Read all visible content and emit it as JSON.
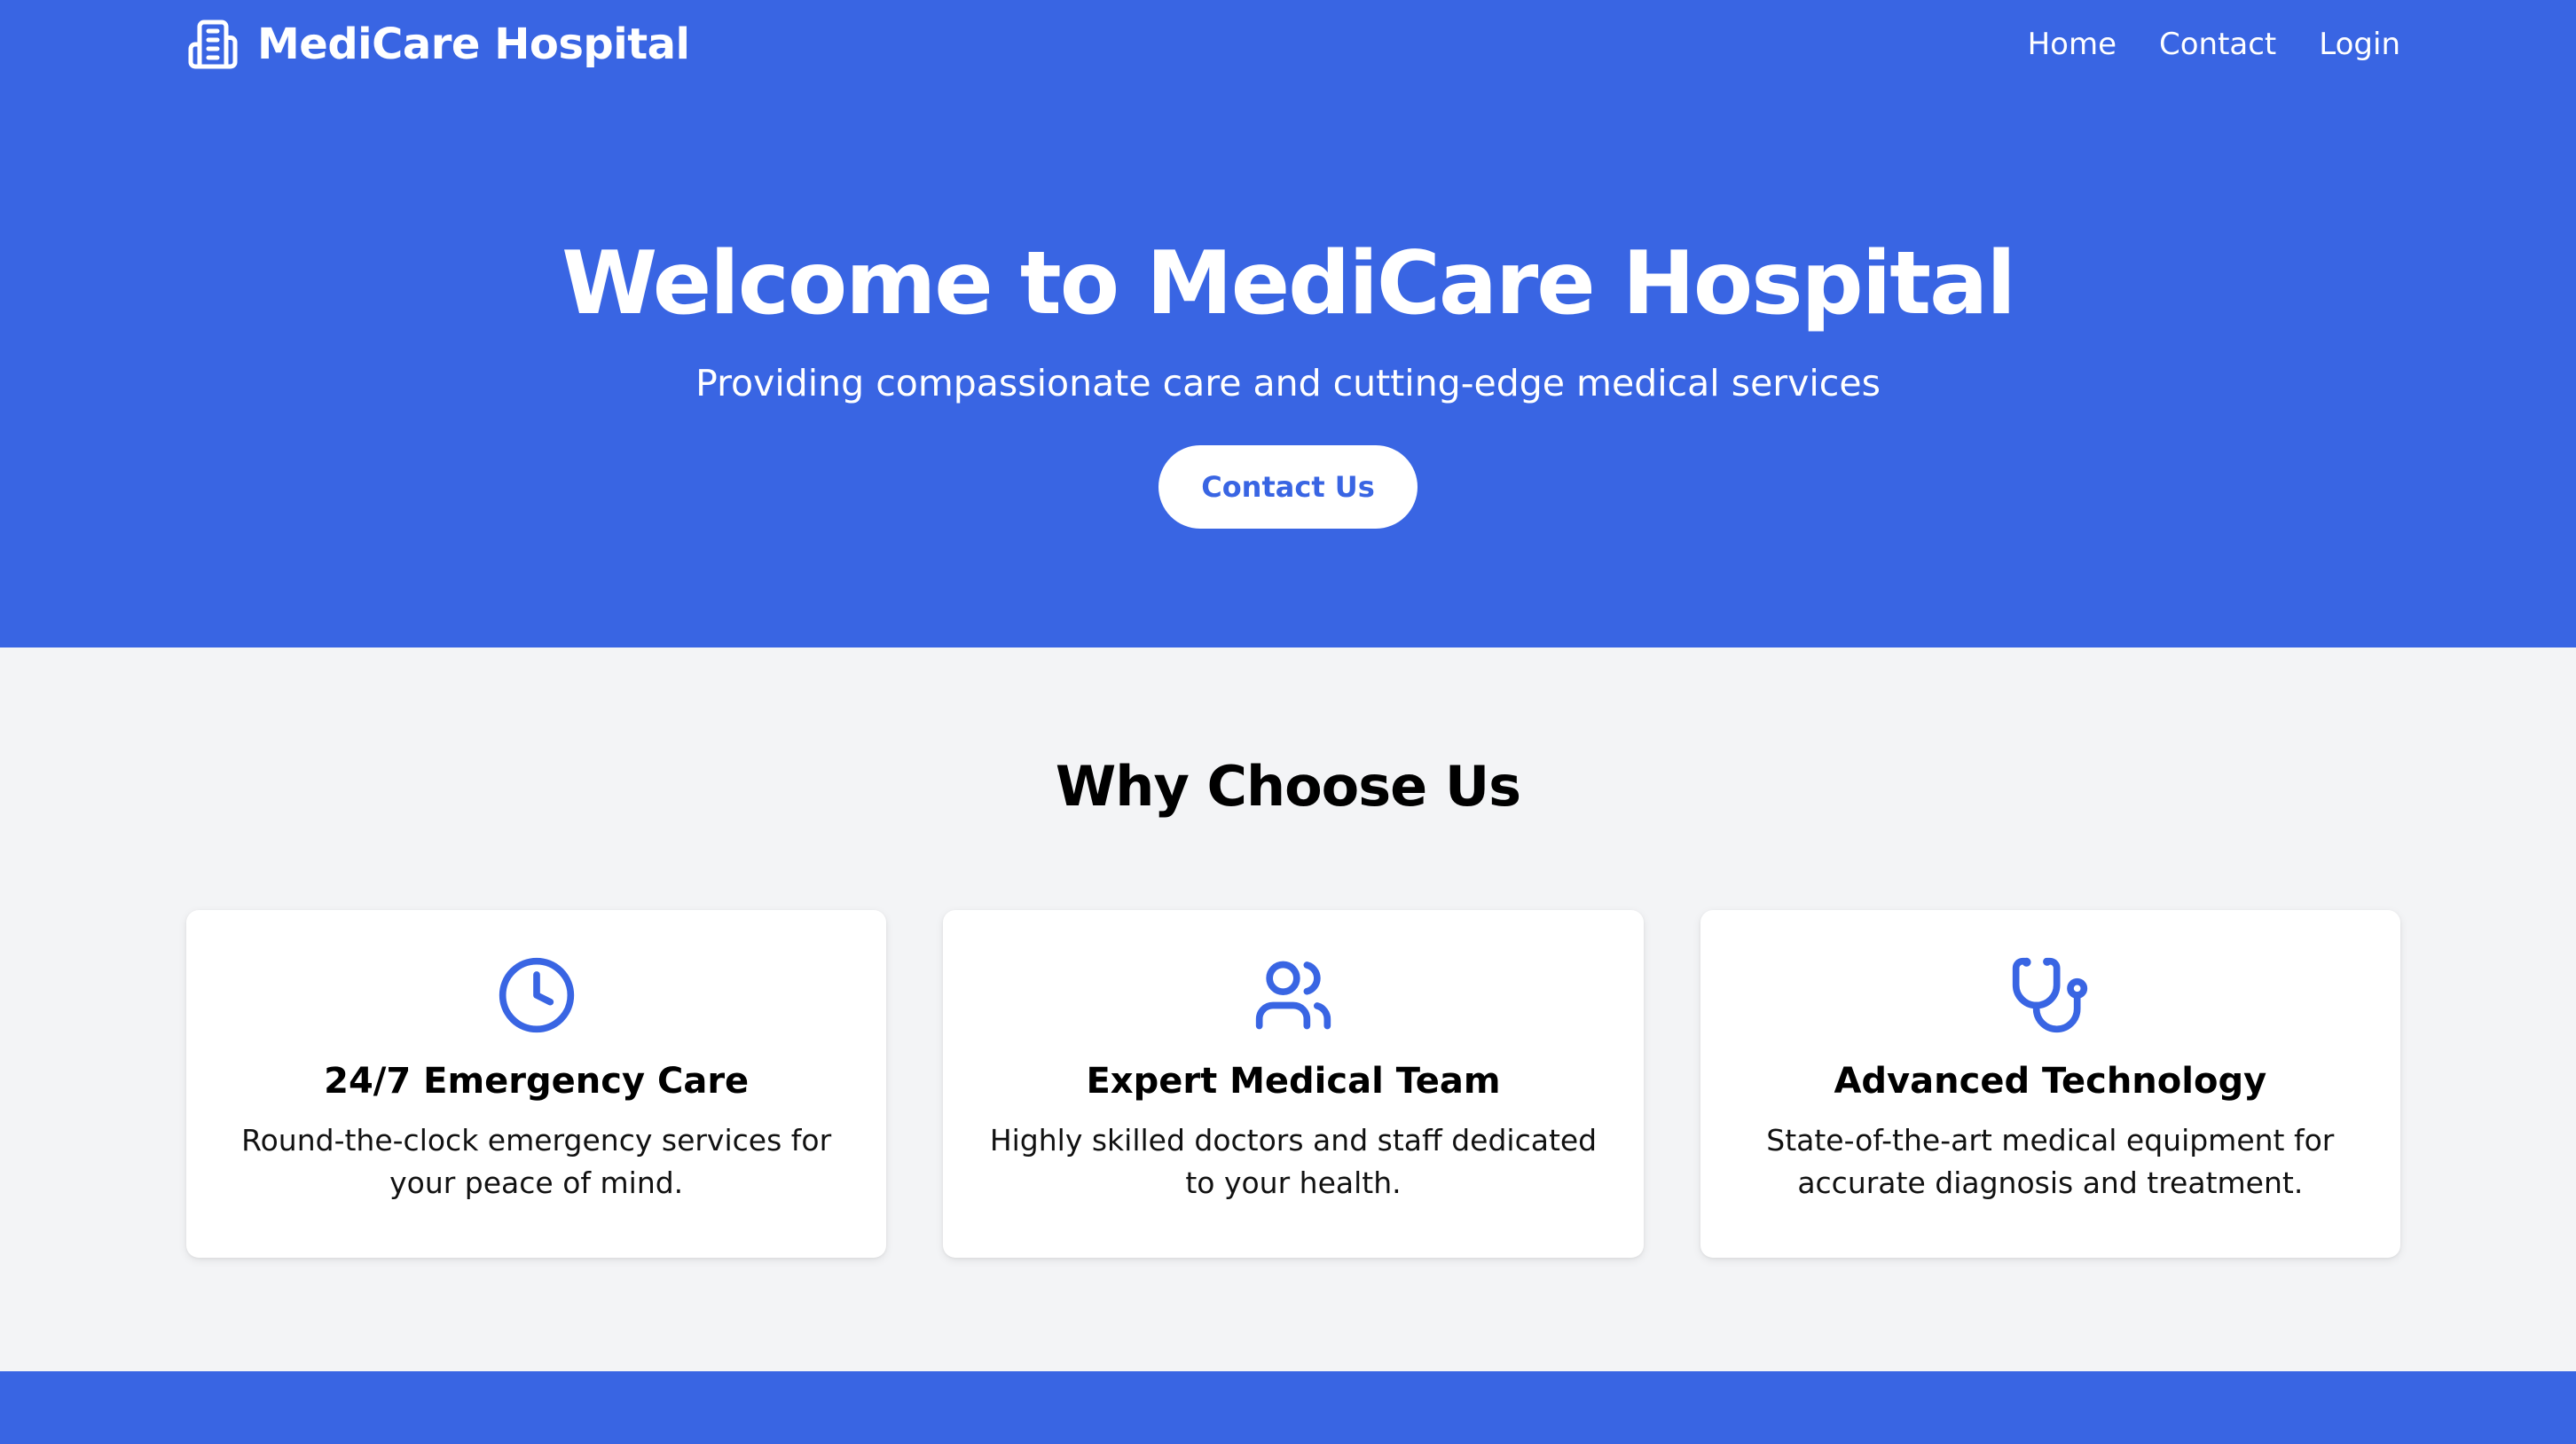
{
  "brand": {
    "name": "MediCare Hospital",
    "icon": "hospital-building-icon"
  },
  "nav": {
    "links": [
      {
        "label": "Home"
      },
      {
        "label": "Contact"
      },
      {
        "label": "Login"
      }
    ]
  },
  "hero": {
    "title": "Welcome to MediCare Hospital",
    "subtitle": "Providing compassionate care and cutting-edge medical services",
    "cta_label": "Contact Us"
  },
  "features": {
    "title": "Why Choose Us",
    "cards": [
      {
        "icon": "clock-icon",
        "title": "24/7 Emergency Care",
        "description": "Round-the-clock emergency services for your peace of mind."
      },
      {
        "icon": "users-icon",
        "title": "Expert Medical Team",
        "description": "Highly skilled doctors and staff dedicated to your health."
      },
      {
        "icon": "stethoscope-icon",
        "title": "Advanced Technology",
        "description": "State-of-the-art medical equipment for accurate diagnosis and treatment."
      }
    ]
  },
  "colors": {
    "primary": "#3965e3",
    "background": "#f3f4f6",
    "card": "#ffffff"
  }
}
